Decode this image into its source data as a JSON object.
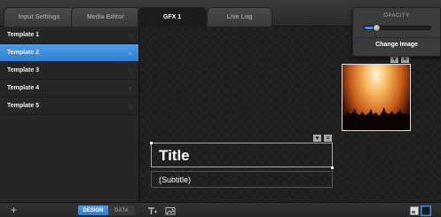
{
  "tabs": [
    {
      "label": "Input Settings",
      "active": false
    },
    {
      "label": "Media Editor",
      "active": false
    },
    {
      "label": "GFX 1",
      "active": true
    },
    {
      "label": "Live Log",
      "active": false
    }
  ],
  "sidebar": {
    "templates": [
      {
        "label": "Template 1",
        "selected": false
      },
      {
        "label": "Template 2",
        "selected": true
      },
      {
        "label": "Template 3",
        "selected": false
      },
      {
        "label": "Template 4",
        "selected": false
      },
      {
        "label": "Template 5",
        "selected": false
      }
    ],
    "remove_glyph": "×"
  },
  "canvas": {
    "title_text": "Title",
    "subtitle_text": "(Subtitle)",
    "element_controls": {
      "menu_glyph": "▾",
      "close_glyph": "×"
    }
  },
  "opacity_panel": {
    "label": "OPACITY",
    "value": 0.18,
    "change_image_label": "Change Image"
  },
  "bottom_bar": {
    "add_glyph": "+",
    "design_label": "DESIGN",
    "data_label": "DATA",
    "active_mode": "design"
  },
  "icons": {
    "add_text": "text-icon",
    "add_image": "image-icon",
    "layout_a": "layout-small-icon",
    "layout_b": "layout-large-icon"
  },
  "colors": {
    "accent": "#3d8fe0",
    "background": "#1b1b1b",
    "sidebar": "#262626"
  }
}
